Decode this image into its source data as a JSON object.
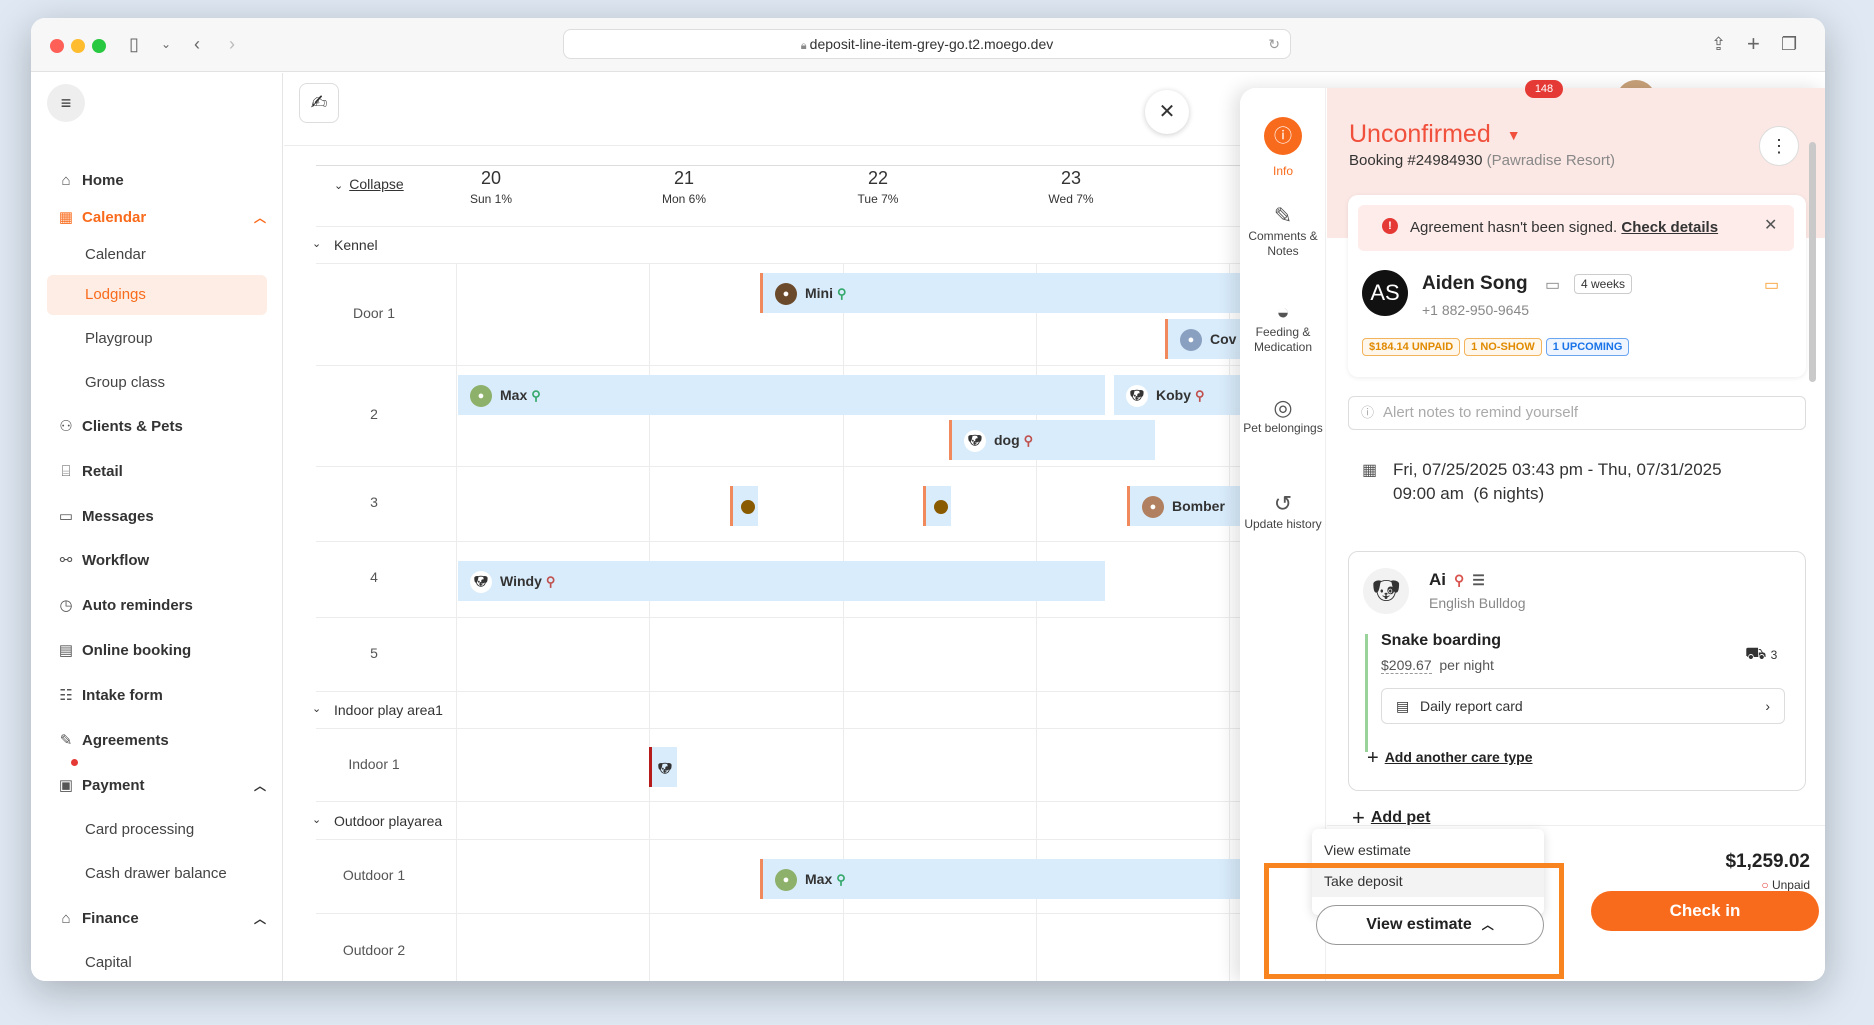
{
  "browser": {
    "url": "deposit-line-item-grey-go.t2.moego.dev"
  },
  "sidebar": {
    "items": [
      {
        "label": "Home",
        "icon": "home-icon"
      },
      {
        "label": "Calendar",
        "icon": "calendar-icon"
      },
      {
        "label": "Clients & Pets",
        "icon": "clients-icon"
      },
      {
        "label": "Retail",
        "icon": "retail-icon"
      },
      {
        "label": "Messages",
        "icon": "messages-icon"
      },
      {
        "label": "Workflow",
        "icon": "workflow-icon"
      },
      {
        "label": "Auto reminders",
        "icon": "reminder-icon"
      },
      {
        "label": "Online booking",
        "icon": "booking-icon"
      },
      {
        "label": "Intake form",
        "icon": "form-icon"
      },
      {
        "label": "Agreements",
        "icon": "agreement-icon"
      },
      {
        "label": "Payment",
        "icon": "payment-icon"
      },
      {
        "label": "Finance",
        "icon": "finance-icon"
      }
    ],
    "calendar_sub": [
      "Calendar",
      "Lodgings",
      "Playgroup",
      "Group class"
    ],
    "payment_sub": [
      "Card processing",
      "Cash drawer balance"
    ],
    "finance_sub": [
      "Capital"
    ]
  },
  "calendar": {
    "collapse_label": "Collapse",
    "days": [
      {
        "num": "20",
        "label": "Sun 1%"
      },
      {
        "num": "21",
        "label": "Mon 6%"
      },
      {
        "num": "22",
        "label": "Tue 7%"
      },
      {
        "num": "23",
        "label": "Wed 7%"
      }
    ],
    "sections": [
      "Kennel",
      "Indoor play area1",
      "Outdoor playarea"
    ],
    "rows": [
      "Door 1",
      "2",
      "3",
      "4",
      "5",
      "Indoor 1",
      "Outdoor 1",
      "Outdoor 2"
    ],
    "pets": {
      "mini": "Mini",
      "cow": "Cov",
      "max": "Max",
      "koby": "Koby",
      "dog": "dog",
      "bomber": "Bomber",
      "windy": "Windy",
      "max2": "Max"
    }
  },
  "panel": {
    "rail": [
      {
        "label": "Info",
        "icon": "info-icon"
      },
      {
        "label": "Comments & Notes",
        "icon": "comments-icon"
      },
      {
        "label": "Feeding & Medication",
        "icon": "feeding-icon"
      },
      {
        "label": "Pet belongings",
        "icon": "belongings-icon"
      },
      {
        "label": "Update history",
        "icon": "history-icon"
      }
    ],
    "status": "Unconfirmed",
    "booking_no": "Booking #24984930",
    "location": "(Pawradise Resort)",
    "alert_text": "Agreement hasn't been signed.",
    "alert_link": "Check details",
    "client": {
      "initials": "AS",
      "name": "Aiden Song",
      "freq": "4 weeks",
      "phone": "+1 882-950-9645"
    },
    "badges": [
      "$184.14 UNPAID",
      "1 NO-SHOW",
      "1 UPCOMING"
    ],
    "alert_placeholder": "Alert notes to remind yourself",
    "dates_line1": "Fri, 07/25/2025 03:43 pm - Thu, 07/31/2025",
    "dates_line2": "09:00 am  (6 nights)",
    "pet": {
      "name": "Ai",
      "breed": "English Bulldog"
    },
    "service": {
      "name": "Snake boarding",
      "price": "$209.67",
      "unit": "per night",
      "count": "3"
    },
    "report_card": "Daily report card",
    "add_care": "Add another care type",
    "add_pet": "Add pet",
    "menu": [
      "View estimate",
      "Take deposit"
    ],
    "view_estimate_btn": "View estimate",
    "total": "$1,259.02",
    "total_status": "Unpaid",
    "check_in": "Check in",
    "notif_count": "148"
  },
  "colors": {
    "brand": "#f96b1c",
    "highlight": "#f7841e",
    "bar": "#d9ecfb"
  }
}
